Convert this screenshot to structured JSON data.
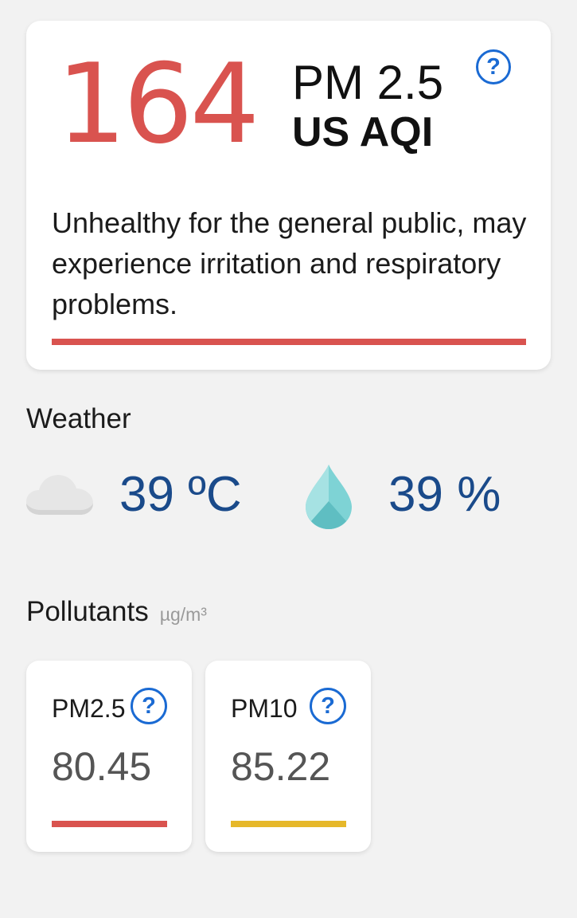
{
  "aqi": {
    "value": "164",
    "pollutant": "PM 2.5",
    "scale": "US AQI",
    "description": "Unhealthy for the general public, may experience irritation and respiratory problems.",
    "color": "#d9534f",
    "help_icon": "question-circle-icon"
  },
  "weather": {
    "title": "Weather",
    "condition_icon": "cloud-icon",
    "temperature": "39 ºC",
    "humidity_icon": "water-drop-icon",
    "humidity": "39 %"
  },
  "pollutants": {
    "title": "Pollutants",
    "unit": "µg/m³",
    "items": [
      {
        "name": "PM2.5",
        "value": "80.45",
        "color": "#d9534f",
        "help_icon": "question-circle-icon"
      },
      {
        "name": "PM10",
        "value": "85.22",
        "color": "#e6b82a",
        "help_icon": "question-circle-icon"
      }
    ]
  },
  "colors": {
    "background": "#f2f2f2",
    "accent_blue": "#1a6ad3",
    "value_blue": "#1a4a8a"
  }
}
